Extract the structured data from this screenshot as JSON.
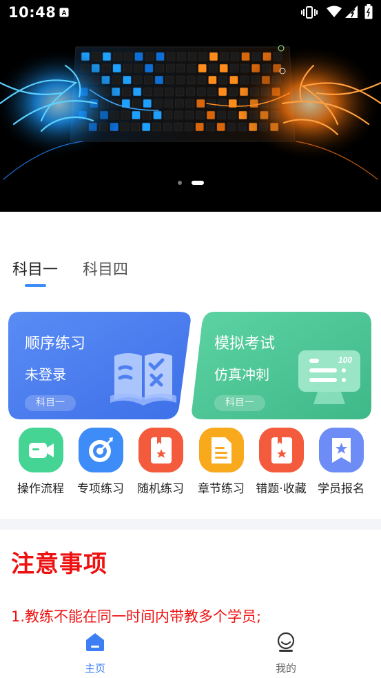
{
  "status_bar": {
    "time": "10:48",
    "icons": [
      "notification-a-icon",
      "vibrate-icon",
      "wifi-icon",
      "signal-icon",
      "battery-icon"
    ]
  },
  "banner": {
    "image": "keyboard-with-blue-and-orange-glowing-dragons",
    "slides": 2,
    "active_slide": 2
  },
  "tabs": [
    {
      "label": "科目一",
      "active": true
    },
    {
      "label": "科目四",
      "active": false
    }
  ],
  "cards": [
    {
      "title": "顺序练习",
      "subtitle": "未登录",
      "badge": "科目一",
      "color": "#4f80f0",
      "icon": "book-check-icon"
    },
    {
      "title": "模拟考试",
      "subtitle": "仿真冲刺",
      "badge": "科目一",
      "color": "#4fc99a",
      "icon": "exam-monitor-icon"
    }
  ],
  "grid": [
    {
      "label": "操作流程",
      "icon": "video-camera-icon",
      "color": "#3cc88a"
    },
    {
      "label": "专项练习",
      "icon": "target-icon",
      "color": "#3d8cf7"
    },
    {
      "label": "随机练习",
      "icon": "star-book-icon",
      "color": "#f0583a"
    },
    {
      "label": "章节练习",
      "icon": "document-icon",
      "color": "#f7a21c"
    },
    {
      "label": "错题·收藏",
      "icon": "bookmark-book-icon",
      "color": "#f0583a"
    },
    {
      "label": "学员报名",
      "icon": "bookmark-star-icon",
      "color": "#5a7ef3"
    }
  ],
  "notice": {
    "title": "注意事项",
    "lines": [
      "1.教练不能在同一时间内带教多个学员;"
    ]
  },
  "bottom_nav": [
    {
      "label": "主页",
      "icon": "home-icon",
      "active": true
    },
    {
      "label": "我的",
      "icon": "profile-icon",
      "active": false
    }
  ],
  "colors": {
    "accent": "#3d7ef5",
    "notice": "#ee1111"
  }
}
